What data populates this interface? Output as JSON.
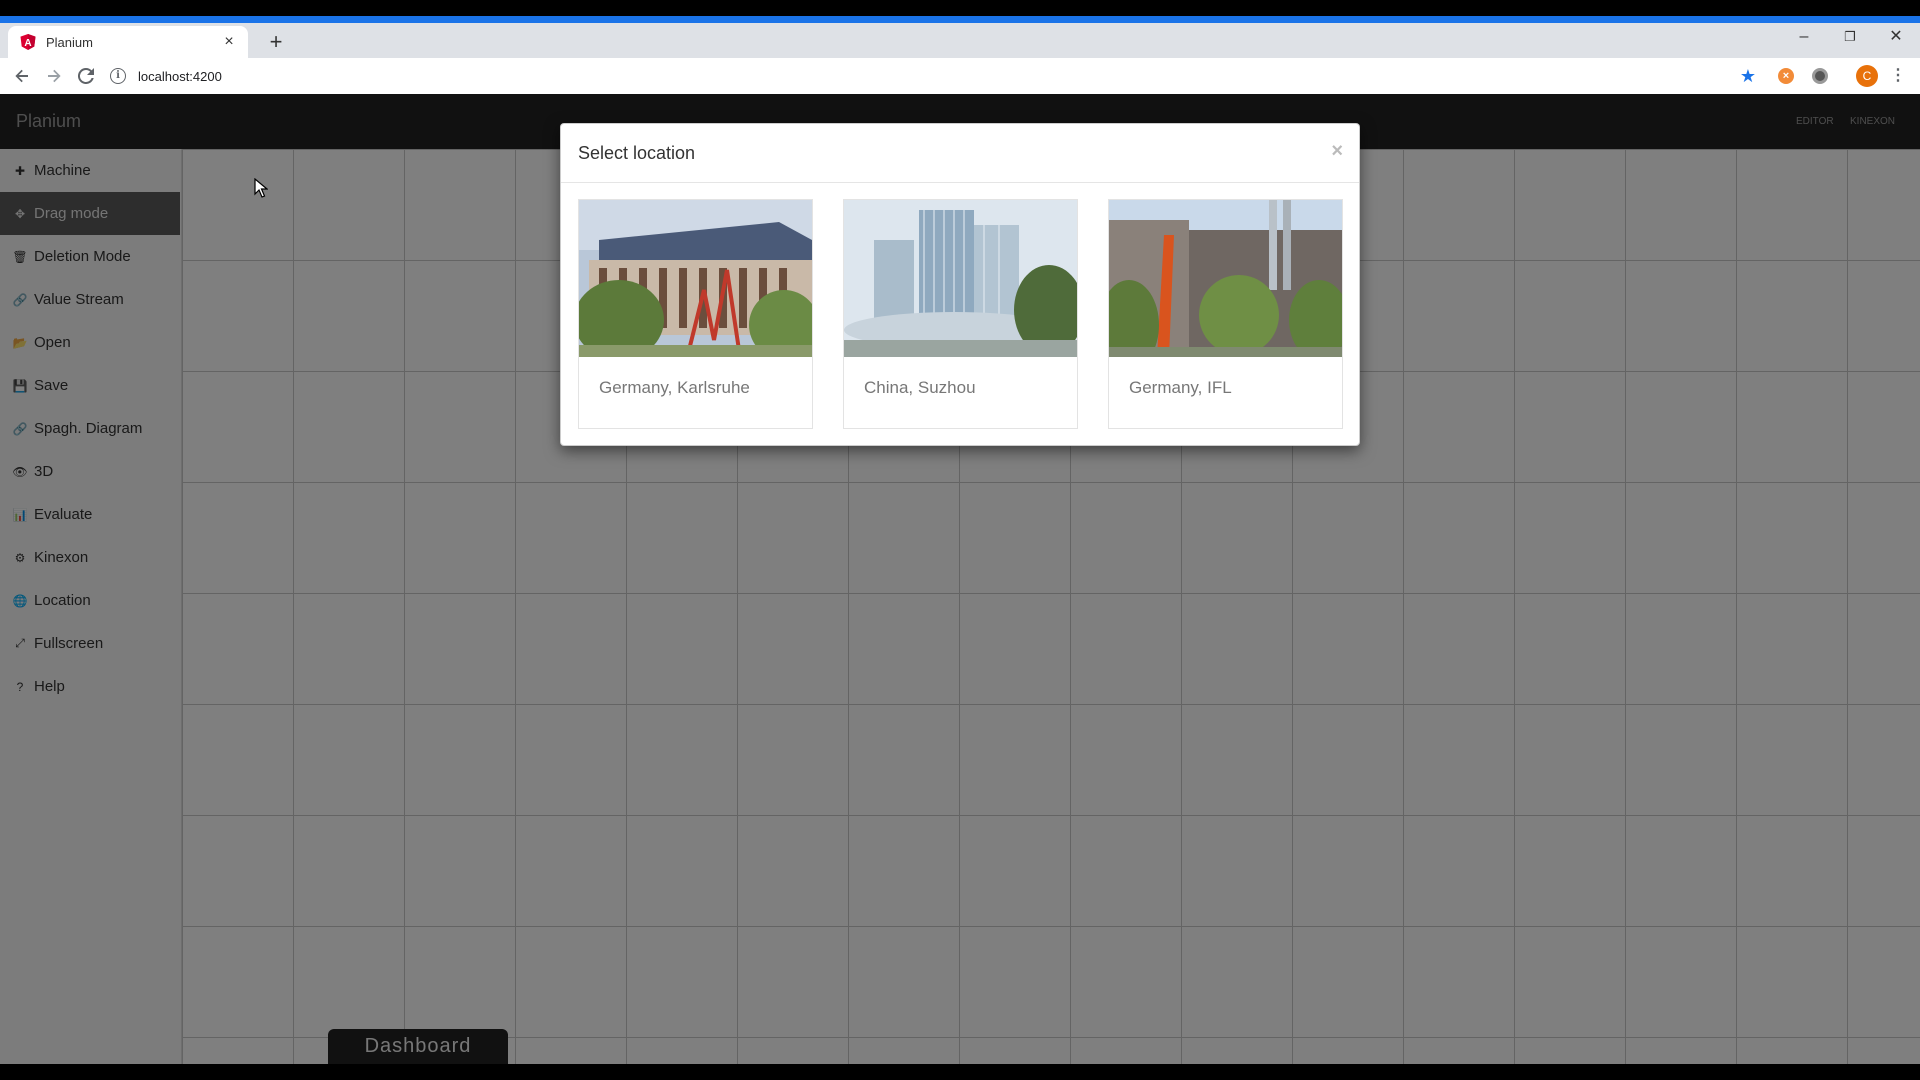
{
  "browser": {
    "tab_title": "Planium",
    "tab_close": "×",
    "new_tab": "+",
    "url": "localhost:4200",
    "info": "i",
    "avatar_initial": "C",
    "window_controls": {
      "minimize": "–",
      "restore": "❐",
      "close": "✕"
    }
  },
  "app": {
    "brand": "Planium",
    "nav_links": [
      "EDITOR",
      "KINEXON"
    ],
    "sidebar": [
      {
        "icon": "✚",
        "label": "Machine",
        "active": false
      },
      {
        "icon": "✥",
        "label": "Drag mode",
        "active": true
      },
      {
        "icon": "🗑",
        "label": "Deletion Mode",
        "active": false
      },
      {
        "icon": "🔗",
        "label": "Value Stream",
        "active": false
      },
      {
        "icon": "📂",
        "label": "Open",
        "active": false
      },
      {
        "icon": "💾",
        "label": "Save",
        "active": false
      },
      {
        "icon": "🔗",
        "label": "Spagh. Diagram",
        "active": false
      },
      {
        "icon": "👁",
        "label": "3D",
        "active": false
      },
      {
        "icon": "📊",
        "label": "Evaluate",
        "active": false
      },
      {
        "icon": "⚙",
        "label": "Kinexon",
        "active": false
      },
      {
        "icon": "🌐",
        "label": "Location",
        "active": false
      },
      {
        "icon": "⤢",
        "label": "Fullscreen",
        "active": false
      },
      {
        "icon": "?",
        "label": "Help",
        "active": false
      }
    ],
    "dashboard_label": "Dashboard"
  },
  "modal": {
    "title": "Select location",
    "close": "×",
    "locations": [
      {
        "label": "Germany, Karlsruhe"
      },
      {
        "label": "China, Suzhou"
      },
      {
        "label": "Germany, IFL"
      }
    ]
  },
  "colors": {
    "browser_accent": "#1a73e8",
    "navbar": "#222222",
    "sidebar_active": "#5a5a5a"
  }
}
